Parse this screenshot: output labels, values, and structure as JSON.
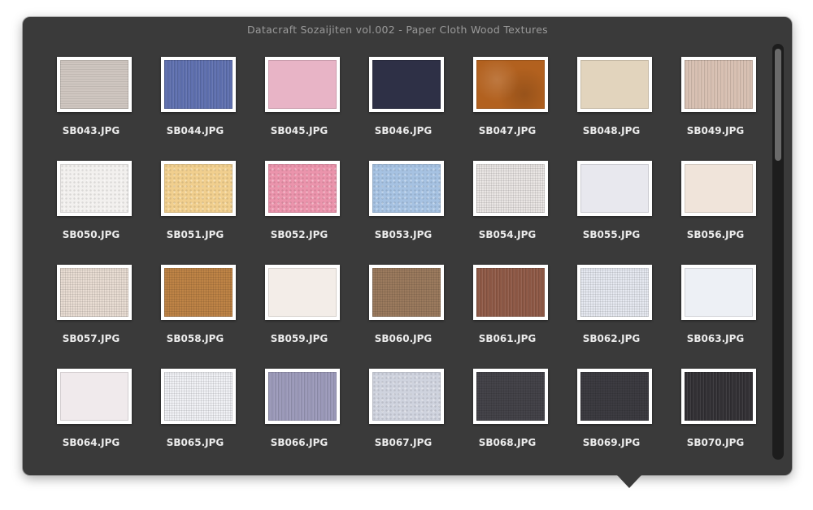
{
  "window": {
    "title": "Datacraft Sozaijiten vol.002 - Paper Cloth Wood Textures"
  },
  "items": [
    {
      "name": "SB043.JPG",
      "color": "#cfc6c0",
      "pattern": "hstripes"
    },
    {
      "name": "SB044.JPG",
      "color": "#5e6fae",
      "pattern": "vstripes"
    },
    {
      "name": "SB045.JPG",
      "color": "#e8b4c6",
      "pattern": "plain"
    },
    {
      "name": "SB046.JPG",
      "color": "#2e3046",
      "pattern": "plain"
    },
    {
      "name": "SB047.JPG",
      "color": "#b2611f",
      "pattern": "mottled"
    },
    {
      "name": "SB048.JPG",
      "color": "#e2d4bd",
      "pattern": "plain"
    },
    {
      "name": "SB049.JPG",
      "color": "#d7bfb1",
      "pattern": "vstripes"
    },
    {
      "name": "SB050.JPG",
      "color": "#f2f0ee",
      "pattern": "speckle"
    },
    {
      "name": "SB051.JPG",
      "color": "#f1cf8e",
      "pattern": "speckle"
    },
    {
      "name": "SB052.JPG",
      "color": "#eb94ac",
      "pattern": "speckle"
    },
    {
      "name": "SB053.JPG",
      "color": "#a6c2e2",
      "pattern": "speckle"
    },
    {
      "name": "SB054.JPG",
      "color": "#eae6e4",
      "pattern": "grid"
    },
    {
      "name": "SB055.JPG",
      "color": "#e8e8ee",
      "pattern": "plain"
    },
    {
      "name": "SB056.JPG",
      "color": "#f0e4da",
      "pattern": "plain"
    },
    {
      "name": "SB057.JPG",
      "color": "#e9ddd3",
      "pattern": "grid"
    },
    {
      "name": "SB058.JPG",
      "color": "#bf8446",
      "pattern": "grid"
    },
    {
      "name": "SB059.JPG",
      "color": "#f3ede8",
      "pattern": "plain"
    },
    {
      "name": "SB060.JPG",
      "color": "#9c7b5e",
      "pattern": "grid"
    },
    {
      "name": "SB061.JPG",
      "color": "#8d5845",
      "pattern": "vstripes"
    },
    {
      "name": "SB062.JPG",
      "color": "#e6e9f1",
      "pattern": "grid"
    },
    {
      "name": "SB063.JPG",
      "color": "#edf0f5",
      "pattern": "plain"
    },
    {
      "name": "SB064.JPG",
      "color": "#f0eaec",
      "pattern": "plain"
    },
    {
      "name": "SB065.JPG",
      "color": "#f1f2f6",
      "pattern": "grid"
    },
    {
      "name": "SB066.JPG",
      "color": "#9a98b8",
      "pattern": "vstripes"
    },
    {
      "name": "SB067.JPG",
      "color": "#cfd3de",
      "pattern": "speckle"
    },
    {
      "name": "SB068.JPG",
      "color": "#45444a",
      "pattern": "grid"
    },
    {
      "name": "SB069.JPG",
      "color": "#3d3c42",
      "pattern": "grid"
    },
    {
      "name": "SB070.JPG",
      "color": "#323034",
      "pattern": "vstripes"
    }
  ],
  "colors": {
    "panel_bg": "#3a3a3a",
    "title_text": "#9a9a9a",
    "label_text": "#ececec",
    "scroll_track": "#1d1d1d",
    "scroll_thumb": "#6a6a6a"
  }
}
